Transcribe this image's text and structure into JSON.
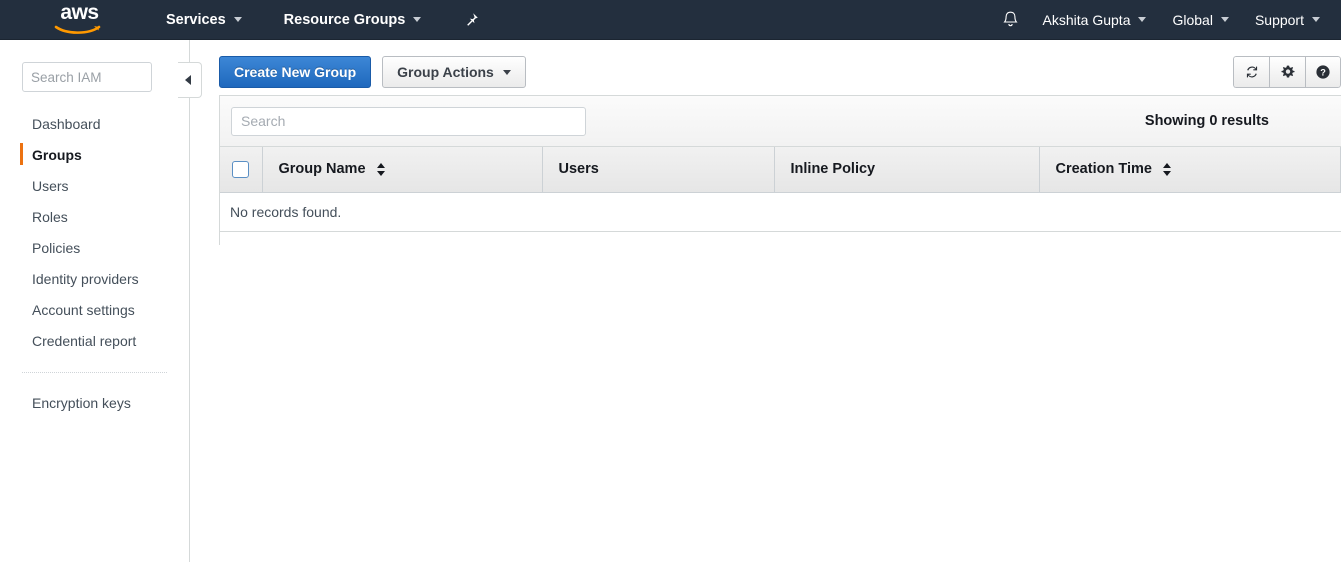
{
  "navbar": {
    "logo_alt": "aws",
    "items": [
      {
        "label": "Services",
        "has_caret": true
      },
      {
        "label": "Resource Groups",
        "has_caret": true
      }
    ],
    "pin_icon": "pin-icon",
    "bell_icon": "bell-icon",
    "right_items": [
      {
        "label": "Akshita Gupta",
        "has_caret": true
      },
      {
        "label": "Global",
        "has_caret": true
      },
      {
        "label": "Support",
        "has_caret": true
      }
    ]
  },
  "sidebar": {
    "search_placeholder": "Search IAM",
    "search_value": "",
    "items": [
      {
        "label": "Dashboard",
        "active": false
      },
      {
        "label": "Groups",
        "active": true
      },
      {
        "label": "Users",
        "active": false
      },
      {
        "label": "Roles",
        "active": false
      },
      {
        "label": "Policies",
        "active": false
      },
      {
        "label": "Identity providers",
        "active": false
      },
      {
        "label": "Account settings",
        "active": false
      },
      {
        "label": "Credential report",
        "active": false
      }
    ],
    "items_secondary": [
      {
        "label": "Encryption keys",
        "active": false
      }
    ],
    "collapse_tooltip": "Collapse sidebar",
    "active_accent_color": "#ec7211"
  },
  "toolbar": {
    "create_label": "Create New Group",
    "actions_label": "Group Actions",
    "primary_color": "#1f68bd",
    "icons": [
      {
        "name": "refresh-icon",
        "title": "Refresh"
      },
      {
        "name": "gear-icon",
        "title": "Settings"
      },
      {
        "name": "help-icon",
        "title": "Help"
      }
    ]
  },
  "table": {
    "search_placeholder": "Search",
    "search_value": "",
    "results_text": "Showing 0 results",
    "columns": [
      {
        "label": "Group Name",
        "sortable": true
      },
      {
        "label": "Users",
        "sortable": false
      },
      {
        "label": "Inline Policy",
        "sortable": false
      },
      {
        "label": "Creation Time",
        "sortable": true
      }
    ],
    "empty_message": "No records found.",
    "rows": []
  }
}
